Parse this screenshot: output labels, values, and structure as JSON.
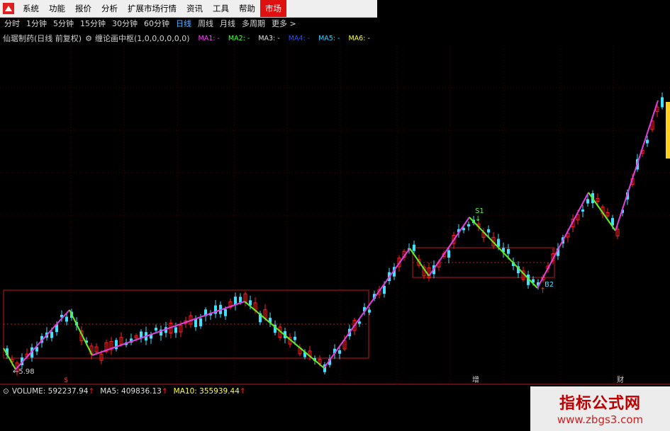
{
  "menu": {
    "items": [
      "系统",
      "功能",
      "报价",
      "分析",
      "扩展市场行情",
      "资讯",
      "工具",
      "帮助"
    ],
    "market_button": "市场"
  },
  "periods": {
    "tabs": [
      "分时",
      "1分钟",
      "5分钟",
      "15分钟",
      "30分钟",
      "60分钟",
      "日线",
      "周线",
      "月线",
      "多周期",
      "更多 >"
    ],
    "active_index": 6
  },
  "info": {
    "stock_title": "仙琚制药(日线 前复权)",
    "indicator": "缠论画中枢(1,0,0,0,0,0,0)",
    "ma_legend": [
      {
        "label": "MA1: -",
        "color": "#ff40ff"
      },
      {
        "label": "MA2: -",
        "color": "#40ff40"
      },
      {
        "label": "MA3: -",
        "color": "#e0e0e0"
      },
      {
        "label": "MA4: -",
        "color": "#3050ff"
      },
      {
        "label": "MA5: -",
        "color": "#30d0ff"
      },
      {
        "label": "MA6: -",
        "color": "#ffff40"
      }
    ]
  },
  "chart": {
    "low_label": "5.98",
    "s1_label": "S1",
    "b2_label": "B2",
    "date_markers": [
      "$",
      "增",
      "财"
    ],
    "colors": {
      "bullish": "#ff2020",
      "bearish": "#40e0ff",
      "up_stroke": "#e040e0",
      "down_stroke": "#60f020",
      "pivot_box": "#c01818"
    }
  },
  "volume": {
    "volume_label": "VOLUME: 592237.94",
    "ma5_label": "MA5: 409836.13",
    "ma10_label": "MA10: 355939.44",
    "arrow": "↑"
  },
  "watermark": {
    "title": "指标公式网",
    "url": "www.zbgs3.com"
  }
}
